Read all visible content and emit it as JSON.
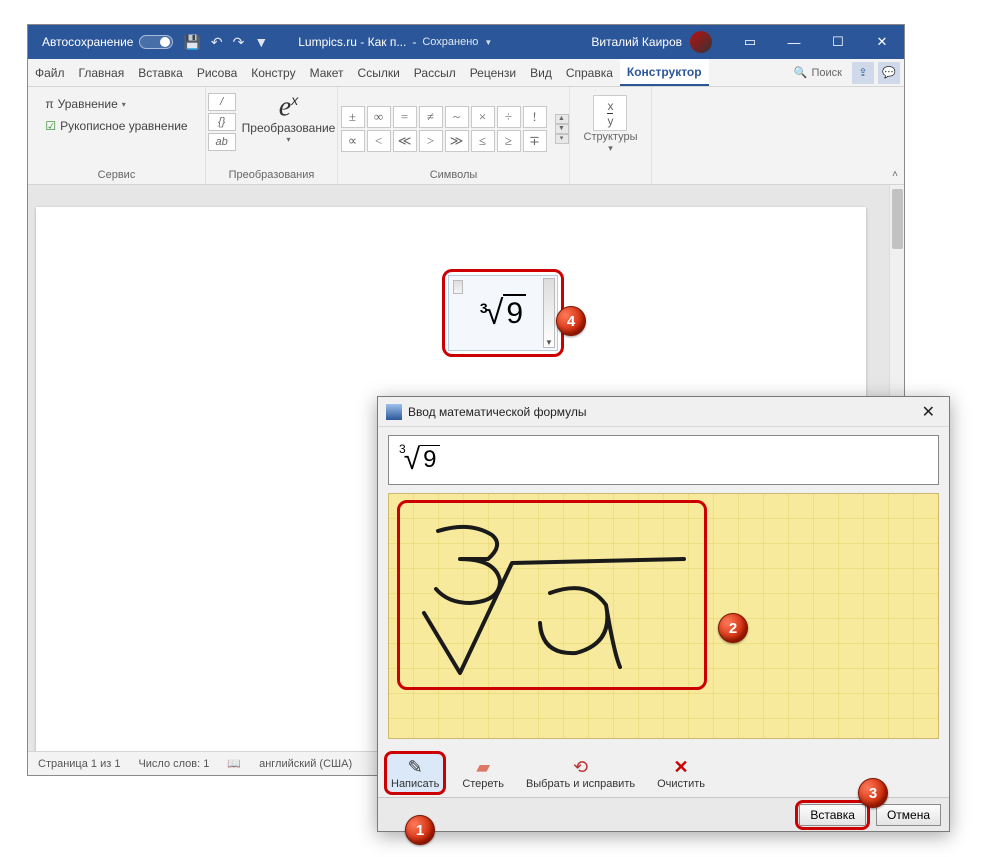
{
  "titlebar": {
    "autosave": "Автосохранение",
    "doc_title": "Lumpics.ru - Как п...",
    "saved": "Сохранено",
    "user": "Виталий Каиров"
  },
  "tabs": {
    "file": "Файл",
    "home": "Главная",
    "insert": "Вставка",
    "draw": "Рисова",
    "design": "Констру",
    "layout": "Макет",
    "references": "Ссылки",
    "mailings": "Рассыл",
    "review": "Рецензи",
    "view": "Вид",
    "help": "Справка",
    "equation": "Конструктор",
    "search": "Поиск"
  },
  "ribbon": {
    "service_group": "Сервис",
    "equation_btn": "Уравнение",
    "ink_equation_btn": "Рукописное уравнение",
    "conversions_group": "Преобразования",
    "convert_btn": "Преобразование",
    "conv_small": {
      "frac": "/",
      "braces": "{}",
      "ab": "ab"
    },
    "symbols_group": "Символы",
    "symbols": [
      "±",
      "∞",
      "=",
      "≠",
      "~",
      "×",
      "÷",
      "!",
      "∝",
      "<",
      "≪",
      ">",
      "≫",
      "≤",
      "≥",
      "∓"
    ],
    "structures_group": "Структуры",
    "structures_btn": "Структуры",
    "structures_sample_top": "x",
    "structures_sample_bot": "y"
  },
  "statusbar": {
    "page": "Страница 1 из 1",
    "words": "Число слов: 1",
    "lang": "английский (США)"
  },
  "equation_obj": {
    "index": "3",
    "radicand": "9"
  },
  "dialog": {
    "title": "Ввод математической формулы",
    "preview": {
      "index": "3",
      "radicand": "9"
    },
    "tools": {
      "write": "Написать",
      "erase": "Стереть",
      "select_fix": "Выбрать и исправить",
      "clear": "Очистить"
    },
    "buttons": {
      "insert": "Вставка",
      "cancel": "Отмена"
    }
  },
  "markers": {
    "m1": "1",
    "m2": "2",
    "m3": "3",
    "m4": "4"
  }
}
